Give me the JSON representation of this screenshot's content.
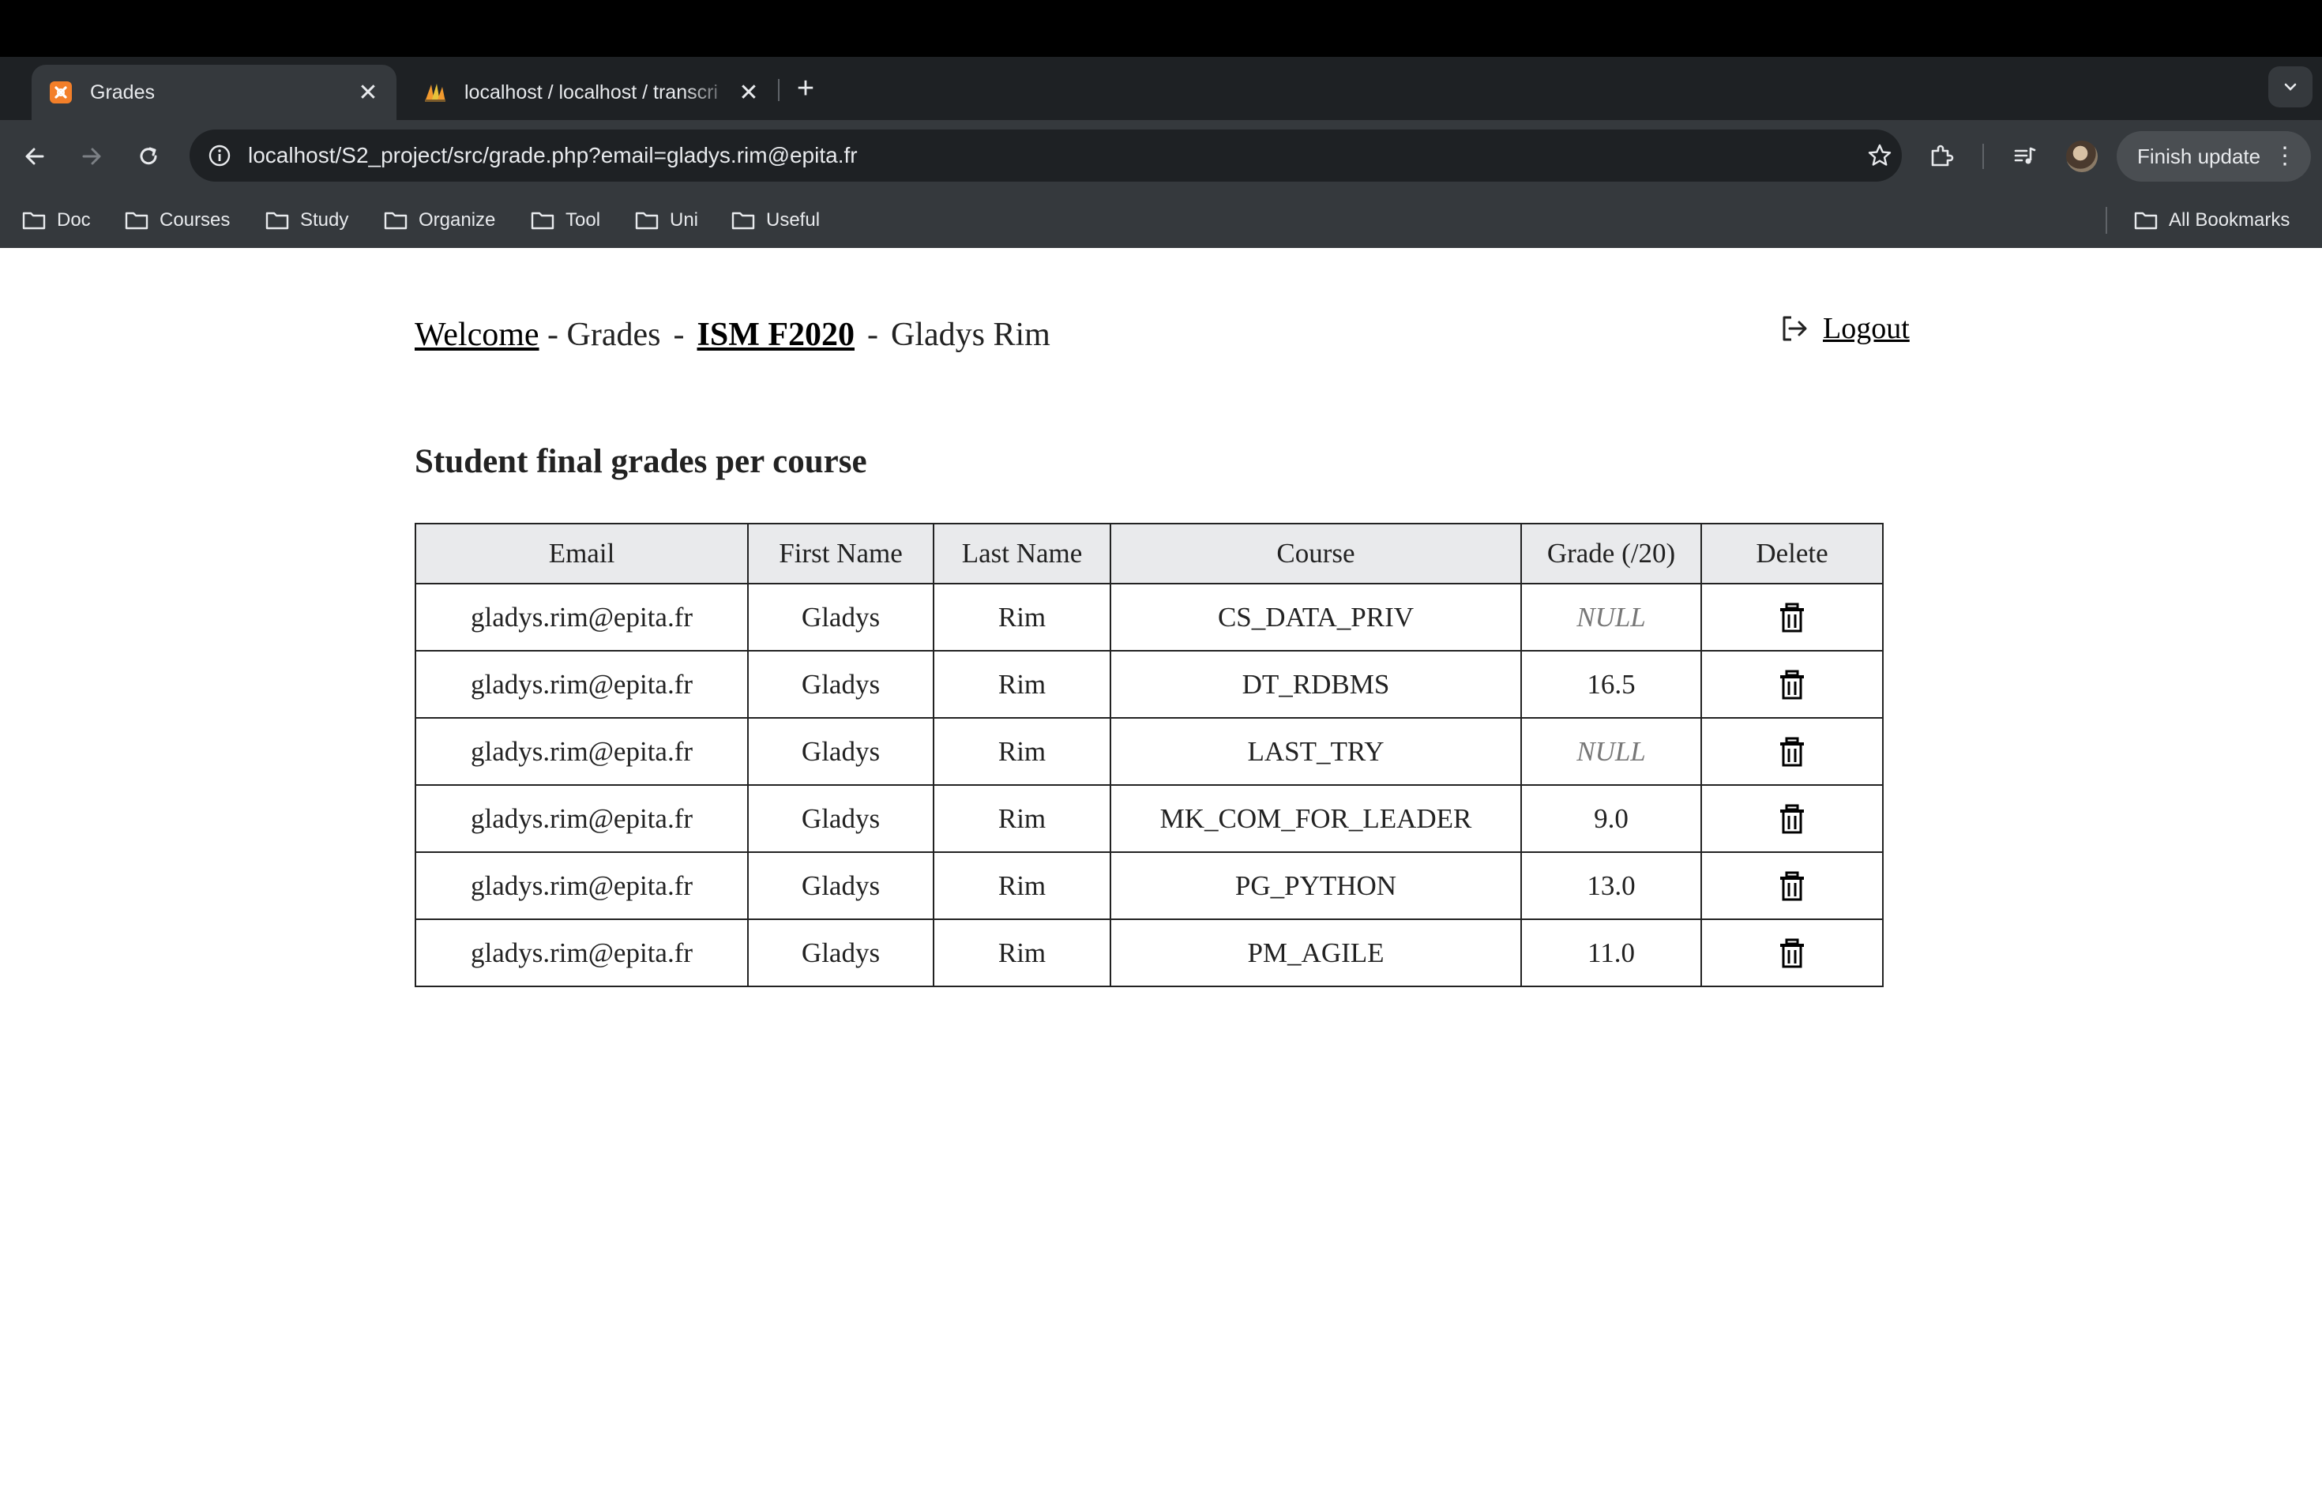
{
  "browser": {
    "tabs": [
      {
        "label": "Grades",
        "active": true,
        "favicon": "xampp-icon"
      },
      {
        "label": "localhost / localhost / transcri",
        "active": false,
        "favicon": "phpmyadmin-icon"
      }
    ],
    "url": "localhost/S2_project/src/grade.php?email=gladys.rim@epita.fr",
    "finish_update_label": "Finish update",
    "bookmarks": [
      "Doc",
      "Courses",
      "Study",
      "Organize",
      "Tool",
      "Uni",
      "Useful"
    ],
    "all_bookmarks_label": "All Bookmarks"
  },
  "page": {
    "nav": {
      "welcome": "Welcome",
      "sep1": "-",
      "grades": "Grades",
      "sep2": "-",
      "course_group": "ISM F2020",
      "sep3": "-",
      "student": "Gladys Rim"
    },
    "logout_label": "Logout",
    "section_title": "Student final grades per course",
    "table": {
      "headers": [
        "Email",
        "First Name",
        "Last Name",
        "Course",
        "Grade (/20)",
        "Delete"
      ],
      "rows": [
        {
          "email": "gladys.rim@epita.fr",
          "first": "Gladys",
          "last": "Rim",
          "course": "CS_DATA_PRIV",
          "grade": "NULL"
        },
        {
          "email": "gladys.rim@epita.fr",
          "first": "Gladys",
          "last": "Rim",
          "course": "DT_RDBMS",
          "grade": "16.5"
        },
        {
          "email": "gladys.rim@epita.fr",
          "first": "Gladys",
          "last": "Rim",
          "course": "LAST_TRY",
          "grade": "NULL"
        },
        {
          "email": "gladys.rim@epita.fr",
          "first": "Gladys",
          "last": "Rim",
          "course": "MK_COM_FOR_LEADER",
          "grade": "9.0"
        },
        {
          "email": "gladys.rim@epita.fr",
          "first": "Gladys",
          "last": "Rim",
          "course": "PG_PYTHON",
          "grade": "13.0"
        },
        {
          "email": "gladys.rim@epita.fr",
          "first": "Gladys",
          "last": "Rim",
          "course": "PM_AGILE",
          "grade": "11.0"
        }
      ]
    }
  }
}
